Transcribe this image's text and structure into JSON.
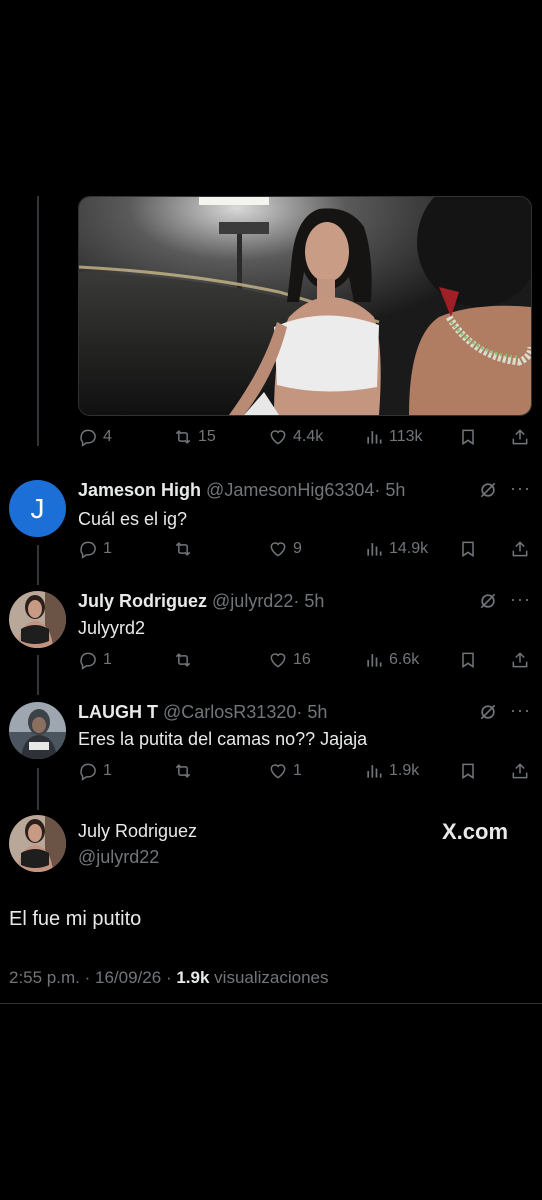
{
  "main_post": {
    "stats": {
      "replies": "4",
      "reposts": "15",
      "likes": "4.4k",
      "views": "113k"
    }
  },
  "replies": [
    {
      "name": "Jameson High",
      "handle": "@JamesonHig63304",
      "time": "· 5h",
      "avatar_letter": "J",
      "text": "Cuál es el ig?",
      "stats": {
        "replies": "1",
        "reposts": "",
        "likes": "9",
        "views": "14.9k"
      }
    },
    {
      "name": "July Rodriguez",
      "handle": "@julyrd22",
      "time": "· 5h",
      "text": "Julyyrd2",
      "stats": {
        "replies": "1",
        "reposts": "",
        "likes": "16",
        "views": "6.6k"
      }
    },
    {
      "name": "LAUGH T",
      "handle": "@CarlosR31320",
      "time": "· 5h",
      "text": "Eres la putita del camas no?? Jajaja",
      "stats": {
        "replies": "1",
        "reposts": "",
        "likes": "1",
        "views": "1.9k"
      }
    }
  ],
  "focus_post": {
    "name": "July Rodriguez",
    "handle": "@julyrd22",
    "watermark": "X.com",
    "text": "El fue mi putito",
    "time": "2:55 p.m.",
    "date": "16/09/26",
    "views_count": "1.9k",
    "views_label": "visualizaciones",
    "sep": "·"
  },
  "colors": {
    "background": "#000000",
    "text": "#e7e9ea",
    "muted": "#71767b",
    "accent": "#1d6fd8"
  }
}
